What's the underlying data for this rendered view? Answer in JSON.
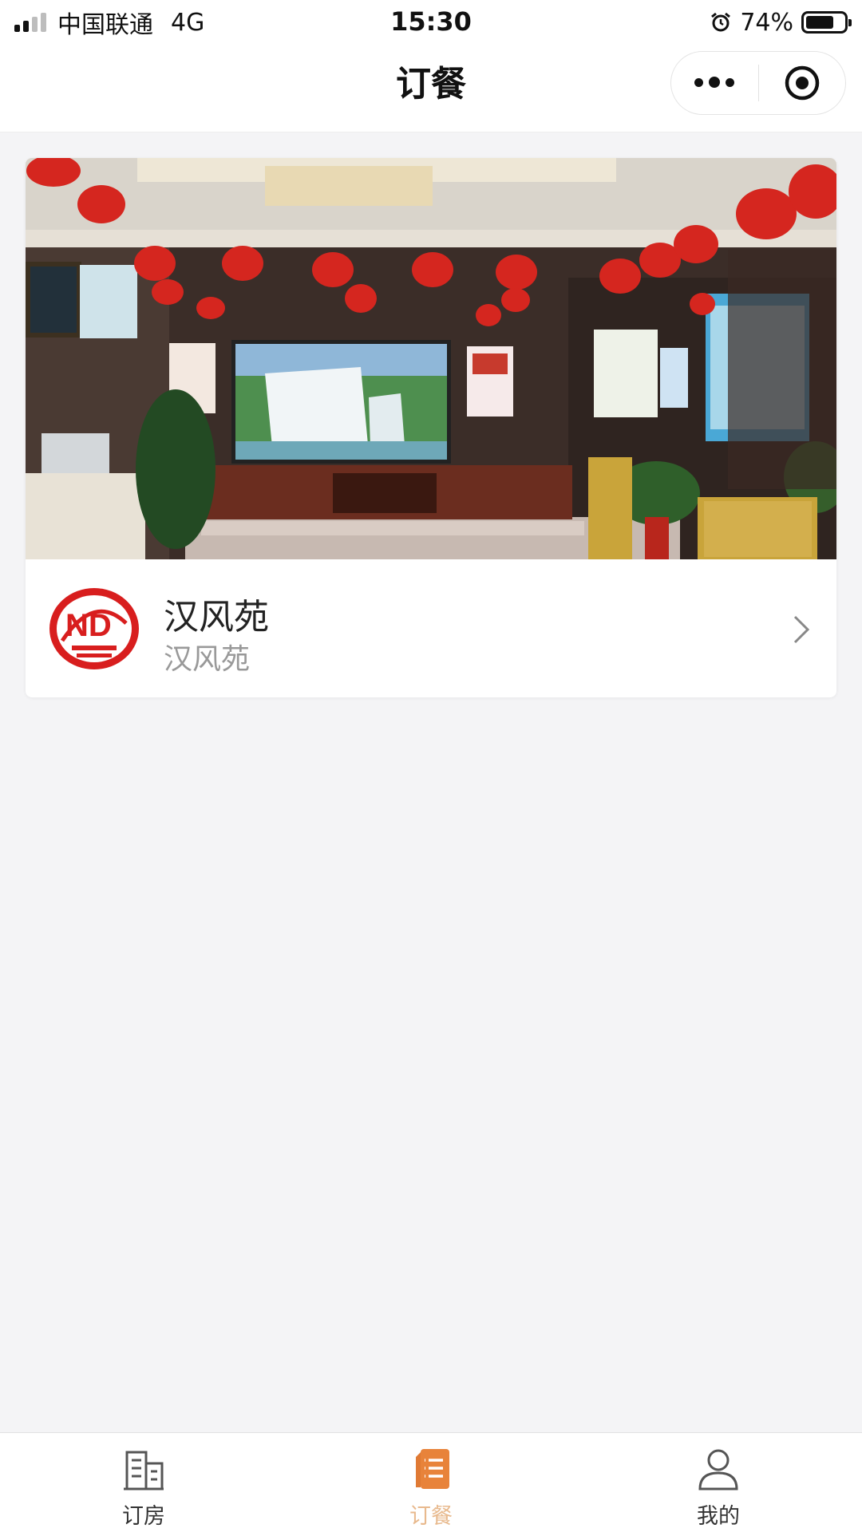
{
  "status_bar": {
    "carrier": "中国联通",
    "network": "4G",
    "time": "15:30",
    "battery": "74%",
    "battery_level": 0.74
  },
  "nav": {
    "title": "订餐",
    "more_icon": "more-dots-icon",
    "close_icon": "target-close-icon"
  },
  "restaurant": {
    "name": "汉风苑",
    "subtitle": "汉风苑",
    "logo_icon": "nd-logo",
    "photo": "lobby-photo-red-lanterns-waterfall"
  },
  "tabs": [
    {
      "label": "订房",
      "icon": "building-icon",
      "active": false
    },
    {
      "label": "订餐",
      "icon": "menu-document-icon",
      "active": true
    },
    {
      "label": "我的",
      "icon": "person-icon",
      "active": false
    }
  ],
  "colors": {
    "accent": "#e8833a",
    "active_tab_label": "#e8b98d",
    "logo_red": "#d81e1e",
    "page_bg": "#f4f4f6"
  }
}
